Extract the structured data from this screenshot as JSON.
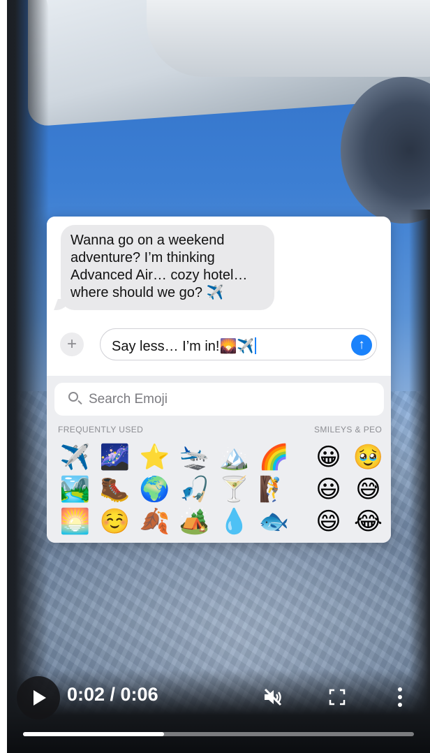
{
  "chat": {
    "received_message": "Wanna go on a weekend adventure? I’m thinking Advanced Air… cozy hotel… where should we go? ✈️",
    "add_icon": "plus-icon",
    "input_value": "Say less… I’m in!🌄✈️",
    "send_icon": "arrow-up-icon"
  },
  "keyboard": {
    "search_placeholder": "Search Emoji",
    "frequently_used_label": "FREQUENTLY USED",
    "smileys_label": "SMILEYS & PEO",
    "frequently_used": [
      "✈️",
      "🌌",
      "⭐",
      "🛬",
      "🏔️",
      "🌈",
      "🏞️",
      "🥾",
      "🌍",
      "🎣",
      "🍸",
      "🧗",
      "🌅",
      "☺️",
      "🍂",
      "🏕️",
      "💧",
      "🐟"
    ],
    "smileys": [
      "😀",
      "🥹",
      "😃",
      "😅",
      "😄",
      "😂"
    ]
  },
  "player": {
    "time": "0:02 / 0:06",
    "progress": 0.36,
    "muted": true,
    "icons": {
      "play": "play-icon",
      "mute": "muted-speaker-icon",
      "fullscreen": "fullscreen-icon",
      "more": "more-vertical-icon"
    },
    "accent_color": "#1a82fb"
  }
}
